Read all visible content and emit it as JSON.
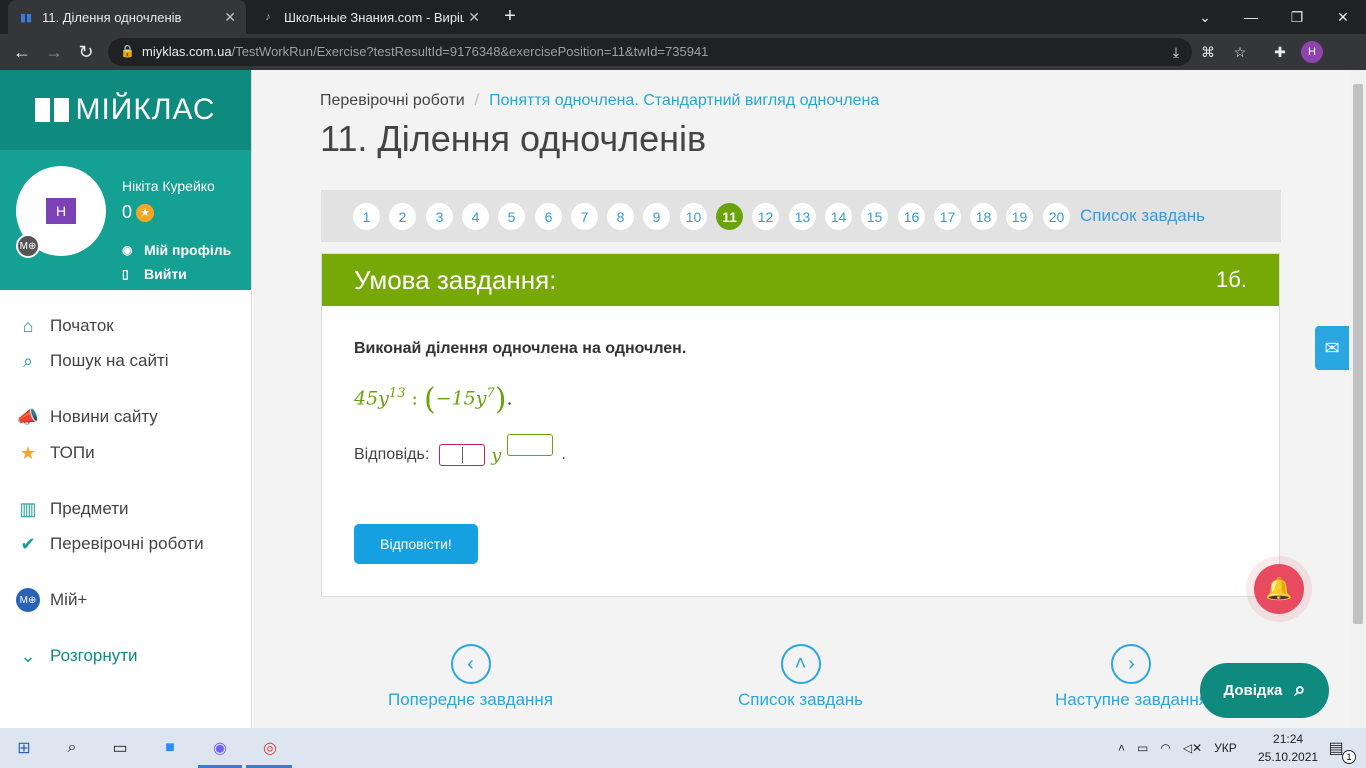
{
  "browser": {
    "tabs": [
      {
        "title": "11. Ділення одночленів",
        "active": true
      },
      {
        "title": "Школьные Знания.com - Вирішу",
        "active": false
      }
    ],
    "url_host": "miyklas.com.ua",
    "url_path": "/TestWorkRun/Exercise?testResultId=9176348&exercisePosition=11&twId=735941",
    "profile_initial": "Н"
  },
  "sidebar": {
    "brand": "МІЙКЛАС",
    "user": {
      "name": "Нікіта Курейко",
      "points": "0",
      "avatar_initial": "Н",
      "badge": "М⊕"
    },
    "user_links": [
      "Мій профіль",
      "Вийти"
    ],
    "menu": [
      {
        "label": "Початок",
        "icon": "home-icon"
      },
      {
        "label": "Пошук на сайті",
        "icon": "search-icon"
      },
      {
        "label": "Новини сайту",
        "icon": "megaphone-icon"
      },
      {
        "label": "ТОПи",
        "icon": "star-icon"
      },
      {
        "label": "Предмети",
        "icon": "books-icon"
      },
      {
        "label": "Перевірочні роботи",
        "icon": "check-circle-icon"
      },
      {
        "label": "Мій+",
        "icon": "moi-plus-icon"
      },
      {
        "label": "Розгорнути",
        "icon": "chevron-down-icon"
      }
    ]
  },
  "breadcrumb": {
    "root": "Перевірочні роботи",
    "current": "Поняття одночлена. Стандартний вигляд одночлена"
  },
  "page_title": "11. Ділення одночленів",
  "pager": {
    "numbers": [
      "1",
      "2",
      "3",
      "4",
      "5",
      "6",
      "7",
      "8",
      "9",
      "10",
      "11",
      "12",
      "13",
      "14",
      "15",
      "16",
      "17",
      "18",
      "19",
      "20"
    ],
    "current": "11",
    "list_link": "Список завдань"
  },
  "card": {
    "heading": "Умова завдання:",
    "points": "1б.",
    "task_text": "Виконай ділення одночлена на одночлен.",
    "formula": {
      "a": "45y",
      "a_exp": "13",
      "op": " : ",
      "b": "−15y",
      "b_exp": "7",
      "end": "."
    },
    "answer_label": "Відповідь:",
    "answer_var": "y",
    "answer_end": ".",
    "submit": "Відповісти!"
  },
  "bottom_nav": {
    "prev": "Попереднє завдання",
    "list": "Список завдань",
    "next": "Наступне завдання"
  },
  "help_button": "Довідка",
  "taskbar": {
    "lang": "УКР",
    "time": "21:24",
    "date": "25.10.2021",
    "notif_count": "1"
  },
  "colors": {
    "teal": "#0e8a7e",
    "green": "#76a905",
    "blue": "#2aa6e1",
    "red_bell": "#e84a5f"
  }
}
